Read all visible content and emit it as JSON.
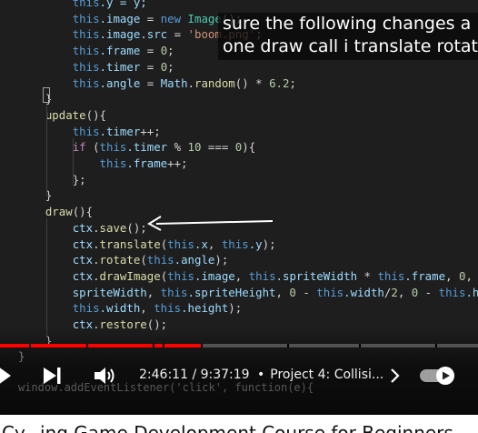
{
  "code": {
    "lines": [
      [
        {
          "t": "        "
        },
        {
          "t": "this",
          "c": "kw"
        },
        {
          "t": ".y = y;",
          "c": "var"
        }
      ],
      [
        {
          "t": "        "
        },
        {
          "t": "this",
          "c": "kw"
        },
        {
          "t": ".image",
          "c": "var"
        },
        {
          "t": " = "
        },
        {
          "t": "new",
          "c": "kw"
        },
        {
          "t": " "
        },
        {
          "t": "Image",
          "c": "cls"
        },
        {
          "t": "();"
        }
      ],
      [
        {
          "t": "        "
        },
        {
          "t": "this",
          "c": "kw"
        },
        {
          "t": ".image.src",
          "c": "var"
        },
        {
          "t": " = "
        },
        {
          "t": "'boom.png'",
          "c": "str"
        },
        {
          "t": ";"
        }
      ],
      [
        {
          "t": "        "
        },
        {
          "t": "this",
          "c": "kw"
        },
        {
          "t": ".frame",
          "c": "var"
        },
        {
          "t": " = "
        },
        {
          "t": "0",
          "c": "num"
        },
        {
          "t": ";"
        }
      ],
      [
        {
          "t": "        "
        },
        {
          "t": "this",
          "c": "kw"
        },
        {
          "t": ".timer",
          "c": "var"
        },
        {
          "t": " = "
        },
        {
          "t": "0",
          "c": "num"
        },
        {
          "t": ";"
        }
      ],
      [
        {
          "t": "        "
        },
        {
          "t": "this",
          "c": "kw"
        },
        {
          "t": ".angle",
          "c": "var"
        },
        {
          "t": " = "
        },
        {
          "t": "Math",
          "c": "var"
        },
        {
          "t": "."
        },
        {
          "t": "random",
          "c": "fn"
        },
        {
          "t": "() * "
        },
        {
          "t": "6.2",
          "c": "num"
        },
        {
          "t": ";"
        }
      ],
      [
        {
          "t": "    "
        },
        {
          "t": "}",
          "c": "br"
        }
      ],
      [
        {
          "t": "    "
        },
        {
          "t": "update",
          "c": "fn"
        },
        {
          "t": "(){"
        }
      ],
      [
        {
          "t": "        "
        },
        {
          "t": "this",
          "c": "kw"
        },
        {
          "t": ".timer",
          "c": "var"
        },
        {
          "t": "++;"
        }
      ],
      [
        {
          "t": "        "
        },
        {
          "t": "if",
          "c": "ctl"
        },
        {
          "t": " ("
        },
        {
          "t": "this",
          "c": "kw"
        },
        {
          "t": ".timer",
          "c": "var"
        },
        {
          "t": " % "
        },
        {
          "t": "10",
          "c": "num"
        },
        {
          "t": " === "
        },
        {
          "t": "0",
          "c": "num"
        },
        {
          "t": "){"
        }
      ],
      [
        {
          "t": "            "
        },
        {
          "t": "this",
          "c": "kw"
        },
        {
          "t": ".frame",
          "c": "var"
        },
        {
          "t": "++;"
        }
      ],
      [
        {
          "t": "        "
        },
        {
          "t": "};"
        }
      ],
      [
        {
          "t": "    "
        },
        {
          "t": "}"
        }
      ],
      [
        {
          "t": "    "
        },
        {
          "t": "draw",
          "c": "fn"
        },
        {
          "t": "(){"
        }
      ],
      [
        {
          "t": "        "
        },
        {
          "t": "ctx",
          "c": "var"
        },
        {
          "t": "."
        },
        {
          "t": "save",
          "c": "fn"
        },
        {
          "t": "();"
        }
      ],
      [
        {
          "t": "        "
        },
        {
          "t": "ctx",
          "c": "var"
        },
        {
          "t": "."
        },
        {
          "t": "translate",
          "c": "fn"
        },
        {
          "t": "("
        },
        {
          "t": "this",
          "c": "kw"
        },
        {
          "t": ".x",
          "c": "var"
        },
        {
          "t": ", "
        },
        {
          "t": "this",
          "c": "kw"
        },
        {
          "t": ".y",
          "c": "var"
        },
        {
          "t": ");"
        }
      ],
      [
        {
          "t": "        "
        },
        {
          "t": "ctx",
          "c": "var"
        },
        {
          "t": "."
        },
        {
          "t": "rotate",
          "c": "fn"
        },
        {
          "t": "("
        },
        {
          "t": "this",
          "c": "kw"
        },
        {
          "t": ".angle",
          "c": "var"
        },
        {
          "t": ");"
        }
      ],
      [
        {
          "t": "        "
        },
        {
          "t": "ctx",
          "c": "var"
        },
        {
          "t": "."
        },
        {
          "t": "drawImage",
          "c": "fn"
        },
        {
          "t": "("
        },
        {
          "t": "this",
          "c": "kw"
        },
        {
          "t": ".image",
          "c": "var"
        },
        {
          "t": ", "
        },
        {
          "t": "this",
          "c": "kw"
        },
        {
          "t": ".spriteWidth",
          "c": "var"
        },
        {
          "t": " * "
        },
        {
          "t": "this",
          "c": "kw"
        },
        {
          "t": ".frame",
          "c": "var"
        },
        {
          "t": ", "
        },
        {
          "t": "0",
          "c": "num"
        },
        {
          "t": ", "
        },
        {
          "t": "this",
          "c": "kw"
        }
      ],
      [
        {
          "t": "        "
        },
        {
          "t": "spriteWidth",
          "c": "var"
        },
        {
          "t": ", "
        },
        {
          "t": "this",
          "c": "kw"
        },
        {
          "t": ".spriteHeight",
          "c": "var"
        },
        {
          "t": ", "
        },
        {
          "t": "0",
          "c": "num"
        },
        {
          "t": " - "
        },
        {
          "t": "this",
          "c": "kw"
        },
        {
          "t": ".width",
          "c": "var"
        },
        {
          "t": "/"
        },
        {
          "t": "2",
          "c": "num"
        },
        {
          "t": ", "
        },
        {
          "t": "0",
          "c": "num"
        },
        {
          "t": " - "
        },
        {
          "t": "this",
          "c": "kw"
        },
        {
          "t": ".heig",
          "c": "var"
        }
      ],
      [
        {
          "t": "        "
        },
        {
          "t": "this",
          "c": "kw"
        },
        {
          "t": ".width",
          "c": "var"
        },
        {
          "t": ", "
        },
        {
          "t": "this",
          "c": "kw"
        },
        {
          "t": ".height",
          "c": "var"
        },
        {
          "t": ");"
        }
      ],
      [
        {
          "t": "        "
        },
        {
          "t": "ctx",
          "c": "var"
        },
        {
          "t": "."
        },
        {
          "t": "restore",
          "c": "fn"
        },
        {
          "t": "();"
        }
      ],
      [
        {
          "t": "    "
        },
        {
          "t": "}"
        }
      ],
      [
        {
          "t": "}"
        }
      ]
    ],
    "bottom_line": "window.addEventListener('click', function(e){"
  },
  "caption": {
    "line1": "sure the following changes a",
    "line2": "one draw call i translate rotat"
  },
  "player": {
    "current_time": "2:46:11",
    "separator": "/",
    "duration": "9:37:19",
    "time_text": "2:46:11 / 9:37:19",
    "chapter_dot": "•",
    "chapter_title": "Project 4: Collisi...",
    "progress_fraction": 0.42,
    "chapter_marks": [
      0.06,
      0.18,
      0.32,
      0.34,
      0.42,
      0.6,
      0.75,
      0.91
    ],
    "accent_color": "#ff0000",
    "icons": [
      "play-icon",
      "next-icon",
      "volume-icon",
      "chevron-right-icon",
      "autoplay-toggle-icon"
    ]
  },
  "page": {
    "title": "Cy...ing Game Development Course for Beginners"
  }
}
